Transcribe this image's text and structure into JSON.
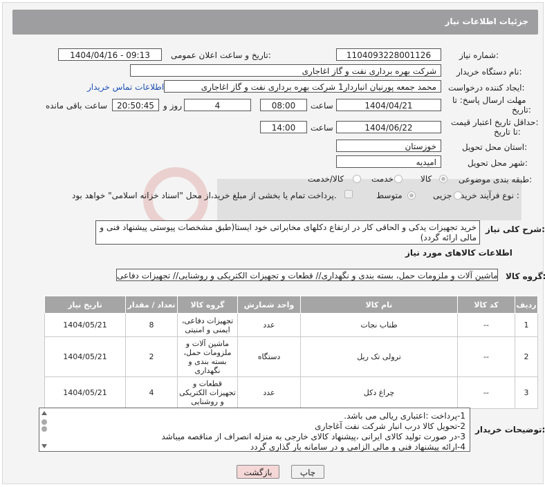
{
  "header": {
    "title": "جزئیات اطلاعات نیاز"
  },
  "form": {
    "need_number_label": "شماره نیاز:",
    "need_number": "1104093228001126",
    "announce_label": "تاریخ و ساعت اعلان عمومی:",
    "announce_value": "1404/04/16 - 09:13",
    "buyer_label": "نام دستگاه خریدار:",
    "buyer_value": "شرکت بهره برداری نفت و گاز اغاجاری",
    "creator_label": "ایجاد کننده درخواست:",
    "creator_value": "محمد جمعه پورنیان انباردار1 شرکت بهره برداری نفت و گاز اغاجاری",
    "contact_link": "اطلاعات تماس خریدار",
    "deadline_label_1": "مهلت ارسال پاسخ: تا",
    "deadline_label_2": "تاریخ:",
    "deadline_date": "1404/04/21",
    "time_label": "ساعت",
    "deadline_time": "08:00",
    "days_value": "4",
    "days_label": "روز و",
    "remaining_time": "20:50:45",
    "remaining_label": "ساعت باقی مانده",
    "validity_label_1": "حداقل تاریخ اعتبار قیمت:",
    "validity_label_2": "تا تاریخ:",
    "validity_date": "1404/06/22",
    "validity_time": "14:00",
    "province_label": "استان محل تحویل:",
    "province_value": "خوزستان",
    "city_label": "شهر محل تحویل:",
    "city_value": "امیدیه",
    "category_label": "طبقه بندی موضوعی:",
    "category_options": [
      "کالا",
      "خدمت",
      "کالا/خدمت"
    ],
    "process_label": "نوع فرآیند خرید :",
    "process_options": [
      "جزیی",
      "متوسط"
    ],
    "payment_note": "پرداخت تمام یا بخشی از مبلغ خرید،از محل \"اسناد خزانه اسلامی\" خواهد بود.",
    "summary_label": "شرح کلی نیاز:",
    "summary_value": "خرید تجهیزات یدکی و الحاقی کار در ارتفاع دکلهای مخابراتی خود ایستا(طبق مشخصات پیوستی پیشنهاد فنی و مالی ارائه گردد)"
  },
  "goods": {
    "section_title": "اطلاعات کالاهای مورد نیاز",
    "group_label": "گروه کالا:",
    "group_value": "ماشین آلات و ملزومات حمل، بسته بندی و نگهداری// قطعات و تجهیزات الکتریکی و روشنایی// تجهیزات دفاعی",
    "columns": [
      "ردیف",
      "کد کالا",
      "نام کالا",
      "واحد شمارش",
      "گروه کالا",
      "تعداد / مقدار",
      "تاریخ نیاز"
    ],
    "rows": [
      {
        "row": "1",
        "code": "--",
        "name": "طناب نجات",
        "unit": "عدد",
        "group": "تجهیزات دفاعی، ایمنی و امنیتی",
        "qty": "8",
        "date": "1404/05/21"
      },
      {
        "row": "2",
        "code": "--",
        "name": "ترولی تک ریل",
        "unit": "دستگاه",
        "group": "ماشین آلات و ملزومات حمل، بسته بندی و نگهداری",
        "qty": "2",
        "date": "1404/05/21"
      },
      {
        "row": "3",
        "code": "--",
        "name": "چراغ دکل",
        "unit": "عدد",
        "group": "قطعات و تجهیزات الکتریکی و روشنایی",
        "qty": "4",
        "date": "1404/05/21"
      }
    ]
  },
  "notes": {
    "label": "توضیحات خریدار:",
    "lines": [
      "1-پرداخت :اعتباری ریالی می باشد.",
      "2-تحویل کالا درب انبار شرکت نفت آغاجاری",
      "3-در صورت تولید کالای ایرانی ،پیشنهاد کالای خارجی به منزله انصراف از مناقصه میباشد",
      "4-ارائه پیشنهاد فنی و مالی الزامی و در سامانه بار گذاری گردد"
    ]
  },
  "buttons": {
    "print": "چاپ",
    "back": "بازگشت"
  },
  "colors": {
    "header_bg": "#9e9ea0",
    "table_header_bg": "#a5a5a5",
    "link": "#1a4fb5",
    "back_button_bg": "#f5d7d7"
  }
}
